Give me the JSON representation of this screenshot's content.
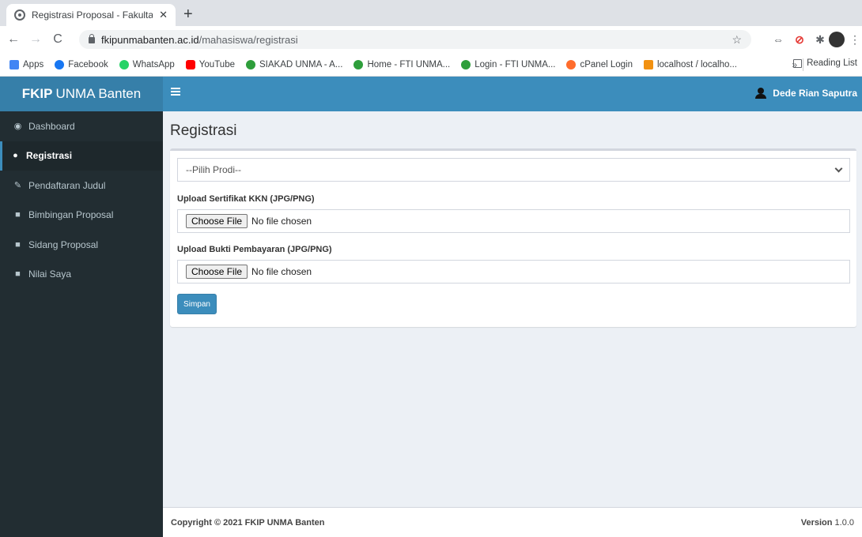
{
  "browser": {
    "tab_title": "Registrasi Proposal - Fakultas K",
    "url_host": "fkipunmabanten.ac.id",
    "url_path": "/mahasiswa/registrasi",
    "bookmarks": [
      {
        "label": "Apps",
        "color": "#4285f4"
      },
      {
        "label": "Facebook",
        "color": "#1877f2"
      },
      {
        "label": "WhatsApp",
        "color": "#25d366"
      },
      {
        "label": "YouTube",
        "color": "#ff0000"
      },
      {
        "label": "SIAKAD UNMA - A...",
        "color": "#2e9e3b"
      },
      {
        "label": "Home - FTI UNMA...",
        "color": "#2e9e3b"
      },
      {
        "label": "Login - FTI UNMA...",
        "color": "#2e9e3b"
      },
      {
        "label": "cPanel Login",
        "color": "#ff6c2c"
      },
      {
        "label": "localhost / localho...",
        "color": "#f29111"
      }
    ],
    "more_bookmarks": "»",
    "reading_list": "Reading List"
  },
  "app": {
    "logo_bold": "FKIP",
    "logo_rest": "UNMA Banten",
    "user_name": "Dede Rian Saputra",
    "accent": "#3c8dbc"
  },
  "sidebar": {
    "items": [
      {
        "label": "Dashboard",
        "icon": "dashboard-icon"
      },
      {
        "label": "Registrasi",
        "icon": "user-icon",
        "active": true
      },
      {
        "label": "Pendaftaran Judul",
        "icon": "edit-icon"
      },
      {
        "label": "Bimbingan Proposal",
        "icon": "file-icon"
      },
      {
        "label": "Sidang Proposal",
        "icon": "file-icon"
      },
      {
        "label": "Nilai Saya",
        "icon": "file-icon"
      }
    ]
  },
  "main": {
    "title": "Registrasi",
    "prodi_select": "--Pilih Prodi--",
    "kkn_label": "Upload Sertifikat KKN (JPG/PNG)",
    "payment_label": "Upload Bukti Pembayaran (JPG/PNG)",
    "choose_file": "Choose File",
    "no_file": "No file chosen",
    "save_button": "Simpan"
  },
  "footer": {
    "copyright": "Copyright © 2021 FKIP UNMA Banten",
    "version_label": "Version",
    "version_value": "1.0.0"
  }
}
